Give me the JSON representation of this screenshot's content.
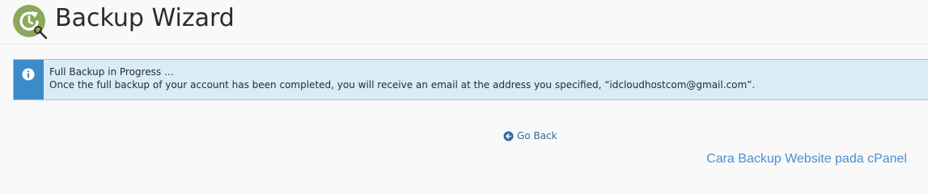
{
  "header": {
    "icon": "backup-restore-icon",
    "title": "Backup Wizard"
  },
  "alert": {
    "icon": "info-circle-icon",
    "title": "Full Backup in Progress …",
    "message": "Once the full backup of your account has been completed, you will receive an email at the address you specified, “idcloudhostcom@gmail.com”."
  },
  "actions": {
    "go_back_icon": "arrow-left-circle-icon",
    "go_back_label": "Go Back"
  },
  "footer": {
    "link_text": "Cara Backup Website pada cPanel"
  },
  "colors": {
    "icon_green": "#8aa95b",
    "info_blue": "#3d8ac9",
    "alert_bg": "#d9edf7",
    "link_blue": "#2f6ea6",
    "footer_link": "#4a8fd0"
  }
}
